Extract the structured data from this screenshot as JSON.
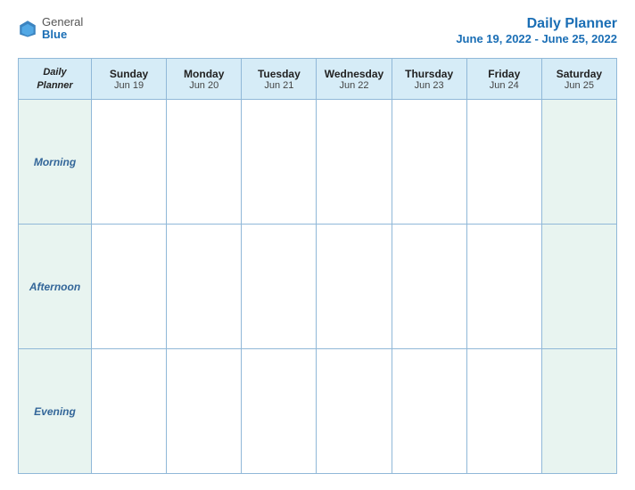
{
  "header": {
    "logo_general": "General",
    "logo_blue": "Blue",
    "title": "Daily Planner",
    "date_range": "June 19, 2022 - June 25, 2022"
  },
  "table": {
    "label_header": "Daily\nPlanner",
    "columns": [
      {
        "day": "Sunday",
        "date": "Jun 19"
      },
      {
        "day": "Monday",
        "date": "Jun 20"
      },
      {
        "day": "Tuesday",
        "date": "Jun 21"
      },
      {
        "day": "Wednesday",
        "date": "Jun 22"
      },
      {
        "day": "Thursday",
        "date": "Jun 23"
      },
      {
        "day": "Friday",
        "date": "Jun 24"
      },
      {
        "day": "Saturday",
        "date": "Jun 25"
      }
    ],
    "rows": [
      {
        "label": "Morning"
      },
      {
        "label": "Afternoon"
      },
      {
        "label": "Evening"
      }
    ]
  }
}
